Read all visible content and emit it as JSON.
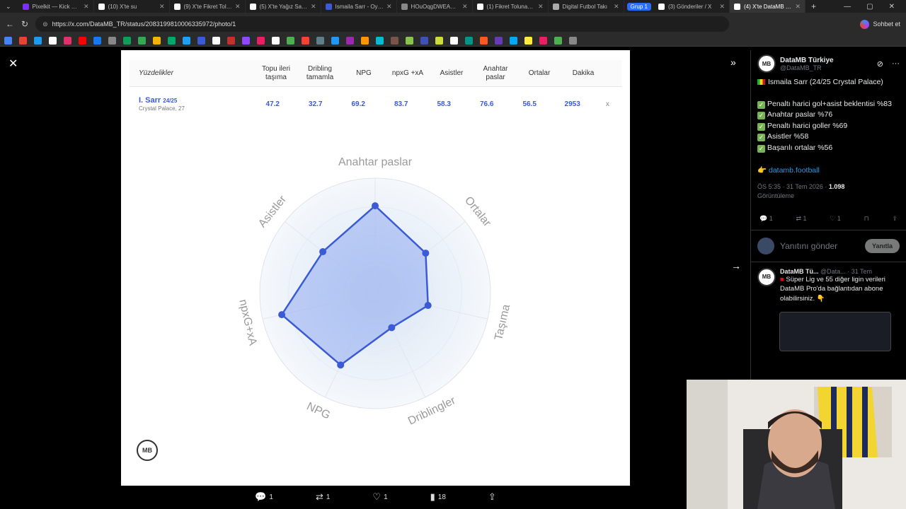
{
  "tabs": [
    {
      "title": "Pixelkit — Kick Overlay",
      "color": "#7b2ff7"
    },
    {
      "title": "(10) X'te su",
      "color": "#ffffff"
    },
    {
      "title": "(9) X'te Fikret Tolunay",
      "color": "#ffffff"
    },
    {
      "title": "(5) X'te Yağız Sabuncu",
      "color": "#ffffff"
    },
    {
      "title": "Ismaila Sarr - Oyuncu",
      "color": "#3b5bd6"
    },
    {
      "title": "HOuOqgDWEAA3dO",
      "color": "#888888"
    },
    {
      "title": "(1) Fikret Tolunay (@",
      "color": "#ffffff"
    },
    {
      "title": "Digital Futbol Takı",
      "color": "#aaaaaa"
    },
    {
      "title": "(3) Gönderiler / X",
      "color": "#ffffff"
    },
    {
      "title": "(4) X'te DataMB Türki",
      "color": "#ffffff"
    }
  ],
  "group_label": "Grup 1",
  "url": "https://x.com/DataMB_TR/status/2083199810006335972/photo/1",
  "chat_label": "Sohbet et",
  "bookmark_colors": [
    "#4285f4",
    "#ea4335",
    "#1d9bf0",
    "#ffffff",
    "#e1306c",
    "#ff0000",
    "#1877f2",
    "#888888",
    "#0f9d58",
    "#34a853",
    "#f4b400",
    "#00a86b",
    "#1da1f2",
    "#3b5bd6",
    "#ffffff",
    "#c4302b",
    "#9146ff",
    "#e91e63",
    "#ffffff",
    "#4caf50",
    "#f44336",
    "#607d8b",
    "#2196f3",
    "#9c27b0",
    "#ff9800",
    "#00bcd4",
    "#795548",
    "#8bc34a",
    "#3f51b5",
    "#cddc39",
    "#ffffff",
    "#009688",
    "#ff5722",
    "#673ab7",
    "#03a9f4",
    "#ffeb3b",
    "#e91e63",
    "#4caf50",
    "#888888"
  ],
  "table": {
    "header_first": "Yüzdelikler",
    "columns": [
      "Topu ileri taşıma",
      "Dribling tamamla",
      "NPG",
      "npxG +xA",
      "Asistler",
      "Anahtar paslar",
      "Ortalar",
      "Dakika"
    ],
    "player_name": "I. Sarr",
    "player_season": "24/25",
    "player_team": "Crystal Palace, 27",
    "values": [
      "47.2",
      "32.7",
      "69.2",
      "83.7",
      "58.3",
      "76.6",
      "56.5",
      "2953"
    ],
    "close": "x"
  },
  "chart_data": {
    "type": "radar",
    "axes": [
      "Anahtar paslar",
      "Ortalar",
      "Taşıma",
      "Driblingler",
      "NPG",
      "npxG+xA",
      "Asistler"
    ],
    "values": [
      0.76,
      0.56,
      0.47,
      0.33,
      0.69,
      0.83,
      0.58
    ],
    "range": [
      0,
      1
    ],
    "fill_color": "#7f9bf0",
    "line_color": "#3b5bd6"
  },
  "logo_text": "MB",
  "action_bar": {
    "replies": "1",
    "reposts": "1",
    "likes": "1",
    "views": "18"
  },
  "right_panel": {
    "display_name": "DataMB Türkiye",
    "handle": "@DataMB_TR",
    "tweet_title": "Ismaila Sarr (24/25 Crystal Palace)",
    "bullets": [
      "Penaltı harici gol+asist beklentisi %83",
      "Anahtar paslar %76",
      "Penaltı harici goller %69",
      "Asistler %58",
      "Başarılı ortalar %56"
    ],
    "link": "datamb.football",
    "timestamp": "ÖS 5:35 · 31 Tem 2026 ·",
    "views": "1.098",
    "views_label": "Görüntüleme",
    "stat_replies": "1",
    "stat_reposts": "1",
    "stat_likes": "1",
    "reply_placeholder": "Yanıtını gönder",
    "reply_button": "Yanıtla",
    "reply": {
      "name": "DataMB Tü...",
      "handle": "@Data...",
      "time": "· 31 Tem",
      "text": "Süper Lig ve 55 diğer ligin verileri DataMB Pro'da bağlantıdan abone olabilirsiniz."
    }
  }
}
